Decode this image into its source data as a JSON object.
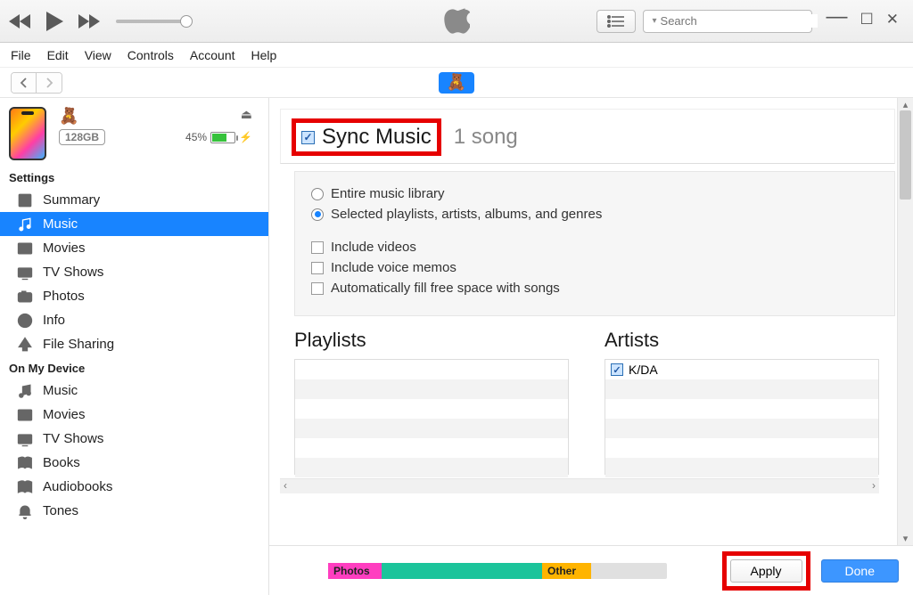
{
  "menu": {
    "file": "File",
    "edit": "Edit",
    "view": "View",
    "controls": "Controls",
    "account": "Account",
    "help": "Help"
  },
  "search": {
    "placeholder": "Search"
  },
  "device": {
    "capacity": "128GB",
    "battery_pct": "45%"
  },
  "sidebar_sections": {
    "settings": "Settings",
    "on_device": "On My Device"
  },
  "settings_items": {
    "summary": "Summary",
    "music": "Music",
    "movies": "Movies",
    "tvshows": "TV Shows",
    "photos": "Photos",
    "info": "Info",
    "filesharing": "File Sharing"
  },
  "device_items": {
    "music": "Music",
    "movies": "Movies",
    "tvshows": "TV Shows",
    "books": "Books",
    "audiobooks": "Audiobooks",
    "tones": "Tones"
  },
  "sync": {
    "title": "Sync Music",
    "count_label": "1 song",
    "opt_entire": "Entire music library",
    "opt_selected": "Selected playlists, artists, albums, and genres",
    "opt_videos": "Include videos",
    "opt_voice": "Include voice memos",
    "opt_autofill": "Automatically fill free space with songs"
  },
  "lists": {
    "playlists_heading": "Playlists",
    "artists_heading": "Artists",
    "artists": [
      {
        "name": "K/DA",
        "checked": true
      }
    ]
  },
  "storage": {
    "photos_label": "Photos",
    "other_label": "Other"
  },
  "buttons": {
    "apply": "Apply",
    "done": "Done"
  }
}
